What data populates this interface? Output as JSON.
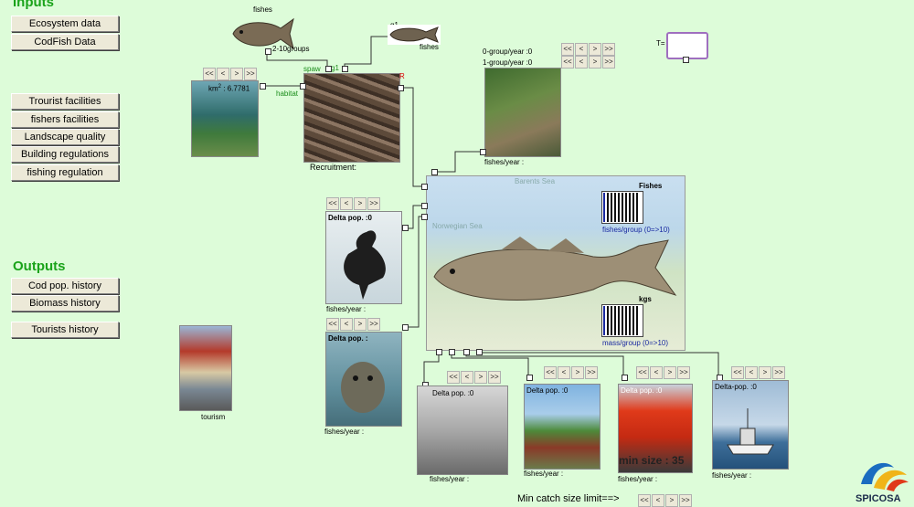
{
  "inputs_heading": "Inputs",
  "outputs_heading": "Outputs",
  "input_buttons": [
    "Ecosystem data",
    "CodFish Data"
  ],
  "facility_buttons": [
    "Trourist facilities",
    "fishers facilities",
    "Landscape quality",
    "Building regulations",
    "fishing regulation"
  ],
  "output_buttons": [
    "Cod pop. history",
    "Biomass history",
    "Tourists history"
  ],
  "nav_labels": [
    "<<",
    "<",
    ">",
    ">>"
  ],
  "fishes_top": {
    "title": "fishes",
    "groups": "2-10groups",
    "spaw": "spaw",
    "g1": "g1"
  },
  "g1_fishes": {
    "title": "g1",
    "label": "fishes"
  },
  "habitat": {
    "km_label": "km",
    "km_sup": "2",
    "km_value": ": 6.7781",
    "link": "habitat"
  },
  "recruitment": {
    "label": "Recruitment:",
    "r_label": "R"
  },
  "fisher_top": {
    "zero_group": "0-group/year :0",
    "one_group": "1-group/year :0",
    "footer": "fishes/year :"
  },
  "timer": {
    "label": "T="
  },
  "map": {
    "barents": "Barents Sea",
    "norwegian": "Norwegian Sea",
    "fishes_label": "Fishes",
    "fishes_axis": "fishes/group (0=>10)",
    "kgs_label": "kgs",
    "mass_axis": "mass/group (0=>10)"
  },
  "cormorant": {
    "delta": "Delta pop. :0",
    "footer": "fishes/year :"
  },
  "seal": {
    "delta": "Delta pop. :",
    "footer": "fishes/year :"
  },
  "tourism": {
    "label": "tourism"
  },
  "net_fishing": {
    "delta": "Delta pop. :0",
    "footer": "fishes/year :"
  },
  "cabin": {
    "delta": "Delta pop. :0",
    "footer": "fishes/year :"
  },
  "angler": {
    "delta": "Delta pop. :0",
    "footer": "fishes/year :",
    "min_size": "min size : 35"
  },
  "trawler": {
    "delta": "Delta-pop. :0",
    "footer": "fishes/year :"
  },
  "min_catch": "Min catch size limit==>",
  "logo_text": "SPICOSA"
}
